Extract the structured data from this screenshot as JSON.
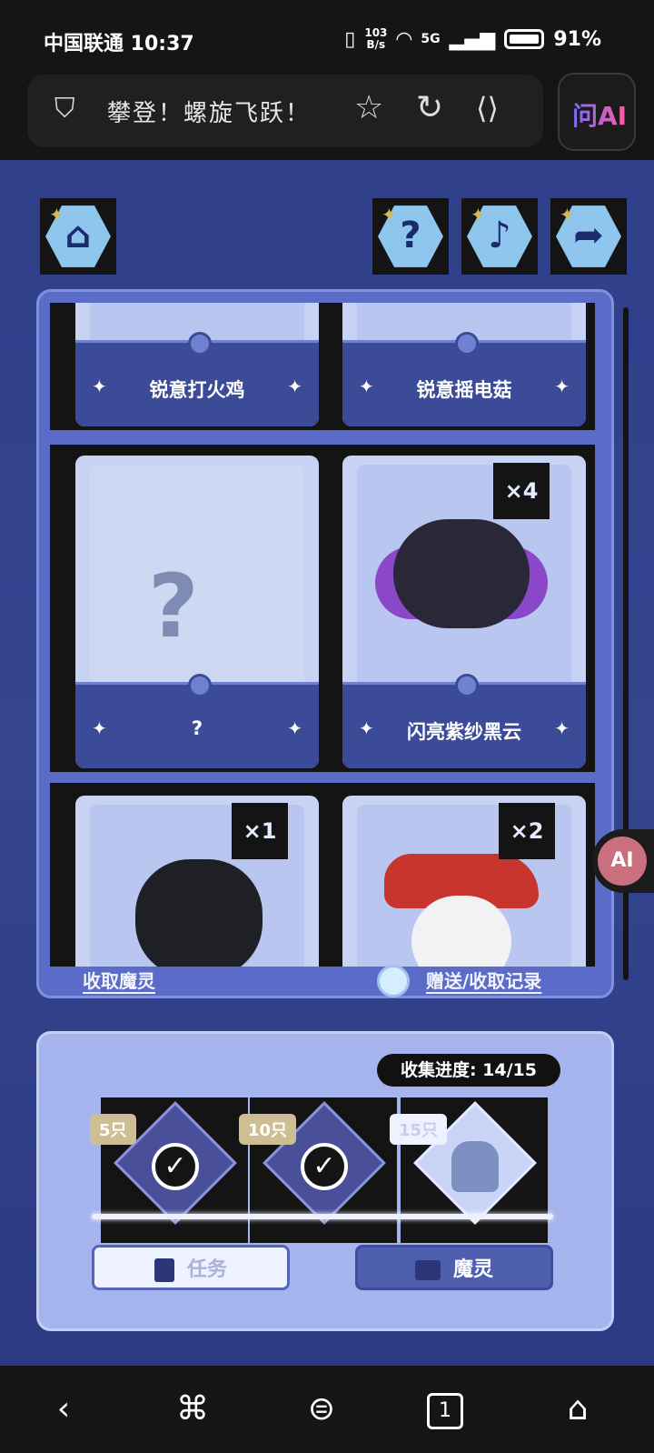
{
  "status_bar": {
    "carrier_time": "中国联通 10:37",
    "net_speed_top": "103",
    "net_speed_unit": "B/s",
    "network": "5G",
    "battery": "91%"
  },
  "browser": {
    "page_title": "攀登！螺旋飞跃！",
    "ask_ai_label": "问AI"
  },
  "game_header": {
    "home_icon": "home-icon",
    "help_icon": "question-icon",
    "music_icon": "music-note-icon",
    "share_icon": "share-arrow-icon"
  },
  "album": {
    "cards": [
      {
        "name": "锐意打火鸡",
        "count": ""
      },
      {
        "name": "锐意摇电菇",
        "count": ""
      },
      {
        "name": "?",
        "count": ""
      },
      {
        "name": "闪亮紫纱黑云",
        "count": "×4"
      },
      {
        "name": "",
        "count": "×1"
      },
      {
        "name": "",
        "count": "×2"
      }
    ],
    "collect_link": "收取魔灵",
    "record_link": "赠送/收取记录"
  },
  "progress": {
    "label": "收集进度:  14/15",
    "collected": 14,
    "total": 15,
    "tiers": [
      {
        "tag": "5只",
        "done": true
      },
      {
        "tag": "10只",
        "done": true
      },
      {
        "tag": "15只",
        "done": false
      }
    ],
    "task_button": "任务",
    "spirit_button": "魔灵"
  },
  "translate_label": "AI"
}
